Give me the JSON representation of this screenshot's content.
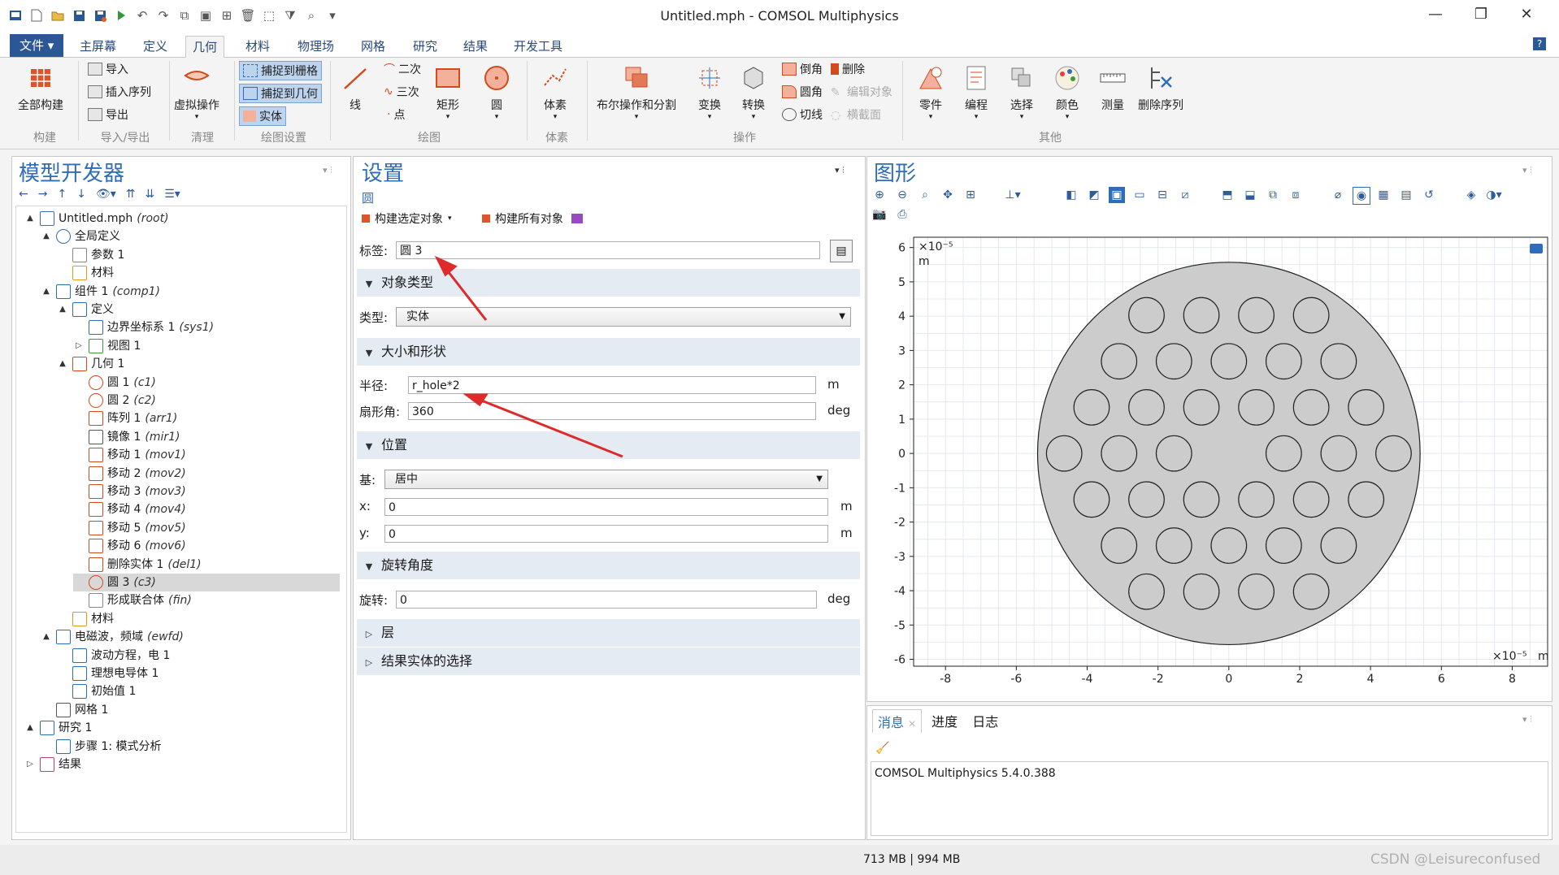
{
  "window": {
    "title": "Untitled.mph - COMSOL Multiphysics"
  },
  "menu_tabs": [
    "文件 ▾",
    "主屏幕",
    "定义",
    "几何",
    "材料",
    "物理场",
    "网格",
    "研究",
    "结果",
    "开发工具"
  ],
  "ribbon": {
    "build_all": "全部构建",
    "import": "导入",
    "insert_sequence": "插入序列",
    "export": "导出",
    "virtual_ops": "虚拟操作",
    "snap_grid": "捕捉到栅格",
    "snap_geom": "捕捉到几何",
    "solid": "实体",
    "line": "线",
    "quadratic": "二次",
    "cubic": "三次",
    "point": "点",
    "rectangle": "矩形",
    "circle": "圆",
    "voxel": "体素",
    "boolean": "布尔操作和分割",
    "transform": "变换",
    "convert": "转换",
    "chamfer": "倒角",
    "fillet": "圆角",
    "tangent": "切线",
    "delete": "删除",
    "edit_object": "编辑对象",
    "cross_section": "横截面",
    "parts": "零件",
    "program": "编程",
    "select": "选择",
    "color": "颜色",
    "measure": "测量",
    "delete_sequence": "删除序列",
    "groups": [
      "构建",
      "导入/导出",
      "清理",
      "绘图设置",
      "绘图",
      "体素",
      "操作",
      "其他"
    ]
  },
  "model_builder": {
    "title": "模型开发器",
    "tree": [
      {
        "label": "Untitled.mph",
        "tag": "(root)"
      },
      {
        "label": "全局定义",
        "tag": ""
      },
      {
        "label": "参数 1",
        "tag": ""
      },
      {
        "label": "材料",
        "tag": ""
      },
      {
        "label": "组件 1",
        "tag": "(comp1)"
      },
      {
        "label": "定义",
        "tag": ""
      },
      {
        "label": "边界坐标系 1",
        "tag": "(sys1)"
      },
      {
        "label": "视图 1",
        "tag": ""
      },
      {
        "label": "几何 1",
        "tag": ""
      },
      {
        "label": "圆 1",
        "tag": "(c1)"
      },
      {
        "label": "圆 2",
        "tag": "(c2)"
      },
      {
        "label": "阵列 1",
        "tag": "(arr1)"
      },
      {
        "label": "镜像 1",
        "tag": "(mir1)"
      },
      {
        "label": "移动 1",
        "tag": "(mov1)"
      },
      {
        "label": "移动 2",
        "tag": "(mov2)"
      },
      {
        "label": "移动 3",
        "tag": "(mov3)"
      },
      {
        "label": "移动 4",
        "tag": "(mov4)"
      },
      {
        "label": "移动 5",
        "tag": "(mov5)"
      },
      {
        "label": "移动 6",
        "tag": "(mov6)"
      },
      {
        "label": "删除实体 1",
        "tag": "(del1)"
      },
      {
        "label": "圆 3",
        "tag": "(c3)"
      },
      {
        "label": "形成联合体",
        "tag": "(fin)"
      },
      {
        "label": "材料",
        "tag": ""
      },
      {
        "label": "电磁波，频域",
        "tag": "(ewfd)"
      },
      {
        "label": "波动方程，电 1",
        "tag": ""
      },
      {
        "label": "理想电导体 1",
        "tag": ""
      },
      {
        "label": "初始值 1",
        "tag": ""
      },
      {
        "label": "网格 1",
        "tag": ""
      },
      {
        "label": "研究 1",
        "tag": ""
      },
      {
        "label": "步骤 1: 模式分析",
        "tag": ""
      },
      {
        "label": "结果",
        "tag": ""
      }
    ]
  },
  "settings": {
    "title": "设置",
    "subtitle": "圆",
    "build_selected": "构建选定对象",
    "build_all": "构建所有对象",
    "label_label": "标签:",
    "label_value": "圆 3",
    "section_object_type": "对象类型",
    "type_label": "类型:",
    "type_value": "实体",
    "section_size": "大小和形状",
    "radius_label": "半径:",
    "radius_value": "r_hole*2",
    "radius_unit": "m",
    "sector_label": "扇形角:",
    "sector_value": "360",
    "sector_unit": "deg",
    "section_position": "位置",
    "base_label": "基:",
    "base_value": "居中",
    "x_label": "x:",
    "x_value": "0",
    "x_unit": "m",
    "y_label": "y:",
    "y_value": "0",
    "y_unit": "m",
    "section_rotation": "旋转角度",
    "rotation_label": "旋转:",
    "rotation_value": "0",
    "rotation_unit": "deg",
    "section_layers": "层",
    "section_result": "结果实体的选择"
  },
  "graphics": {
    "title": "图形",
    "y_exponent": "×10⁻⁵",
    "y_unit": "m",
    "x_exponent": "×10⁻⁵",
    "x_unit": "m",
    "x_ticks": [
      "-8",
      "-6",
      "-4",
      "-2",
      "0",
      "2",
      "4",
      "6",
      "8"
    ],
    "y_ticks": [
      "6",
      "5",
      "4",
      "3",
      "2",
      "1",
      "0",
      "-1",
      "-2",
      "-3",
      "-4",
      "-5",
      "-6"
    ],
    "fill_color": "#cccccc",
    "outer_radius": 5.4,
    "hole_radius": 0.5,
    "hole_pitch": 1.55,
    "hole_rows": [
      4,
      5,
      6,
      7,
      6,
      5,
      4
    ],
    "missing_hole": "center"
  },
  "messages": {
    "tabs": [
      "消息",
      "进度",
      "日志"
    ],
    "text": "COMSOL Multiphysics 5.4.0.388"
  },
  "status": {
    "memory": "713 MB | 994 MB",
    "watermark": "CSDN @Leisureconfused"
  }
}
